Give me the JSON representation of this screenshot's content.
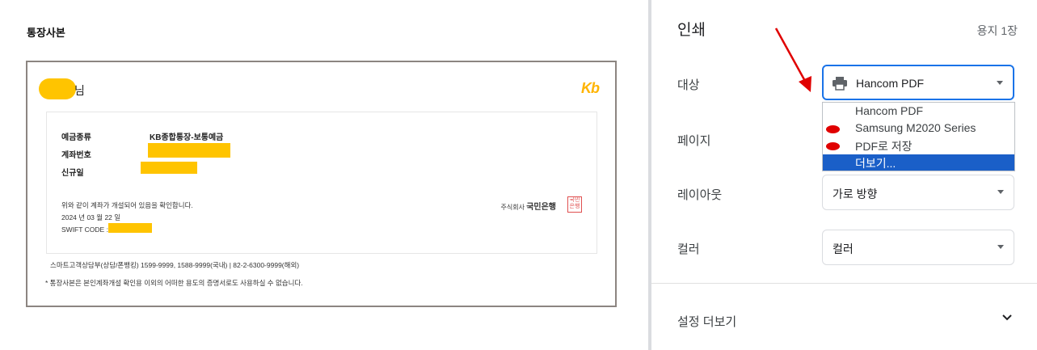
{
  "preview": {
    "title": "통장사본",
    "name_suffix": "님",
    "logo": "Kb",
    "fields": [
      {
        "label": "예금종류",
        "value": "KB종합통장-보통예금"
      },
      {
        "label": "계좌번호",
        "value": ""
      },
      {
        "label": "신규일",
        "value": ""
      }
    ],
    "cert_line": "위와 같이 계좌가 개설되어 있음을 확인합니다.",
    "date_line": "2024 년 03 월 22 일",
    "swift_label": "SWIFT CODE :",
    "stamp_corp_prefix": "주식회사",
    "stamp_corp_name": "국민은행",
    "stamp_seal": "국민은행",
    "footer_contact": "스마트고객상담부(상담/폰뱅킹) 1599-9999, 1588-9999(국내) | 82-2-6300-9999(해외)",
    "footer_notice": "* 통장사본은 본인계좌개설 확인용 이외의 어떠한 용도의 증명서로도 사용하실 수 없습니다."
  },
  "print_panel": {
    "title": "인쇄",
    "sheets": "용지 1장",
    "destination": {
      "label": "대상",
      "value": "Hancom PDF",
      "icon": "printer-icon"
    },
    "dropdown_options": [
      {
        "label": "Hancom PDF",
        "marked": false,
        "selected": false
      },
      {
        "label": "Samsung M2020 Series",
        "marked": true,
        "selected": false
      },
      {
        "label": "PDF로 저장",
        "marked": true,
        "selected": false
      },
      {
        "label": "더보기...",
        "marked": false,
        "selected": true
      }
    ],
    "pages": {
      "label": "페이지"
    },
    "layout": {
      "label": "레이아웃",
      "value": "가로 방향"
    },
    "color": {
      "label": "컬러",
      "value": "컬러"
    },
    "more_settings": "설정 더보기"
  },
  "colors": {
    "accent": "#1a73e8",
    "highlight": "#1a5fc8",
    "annotation": "#e00000",
    "mask": "#ffc400"
  }
}
